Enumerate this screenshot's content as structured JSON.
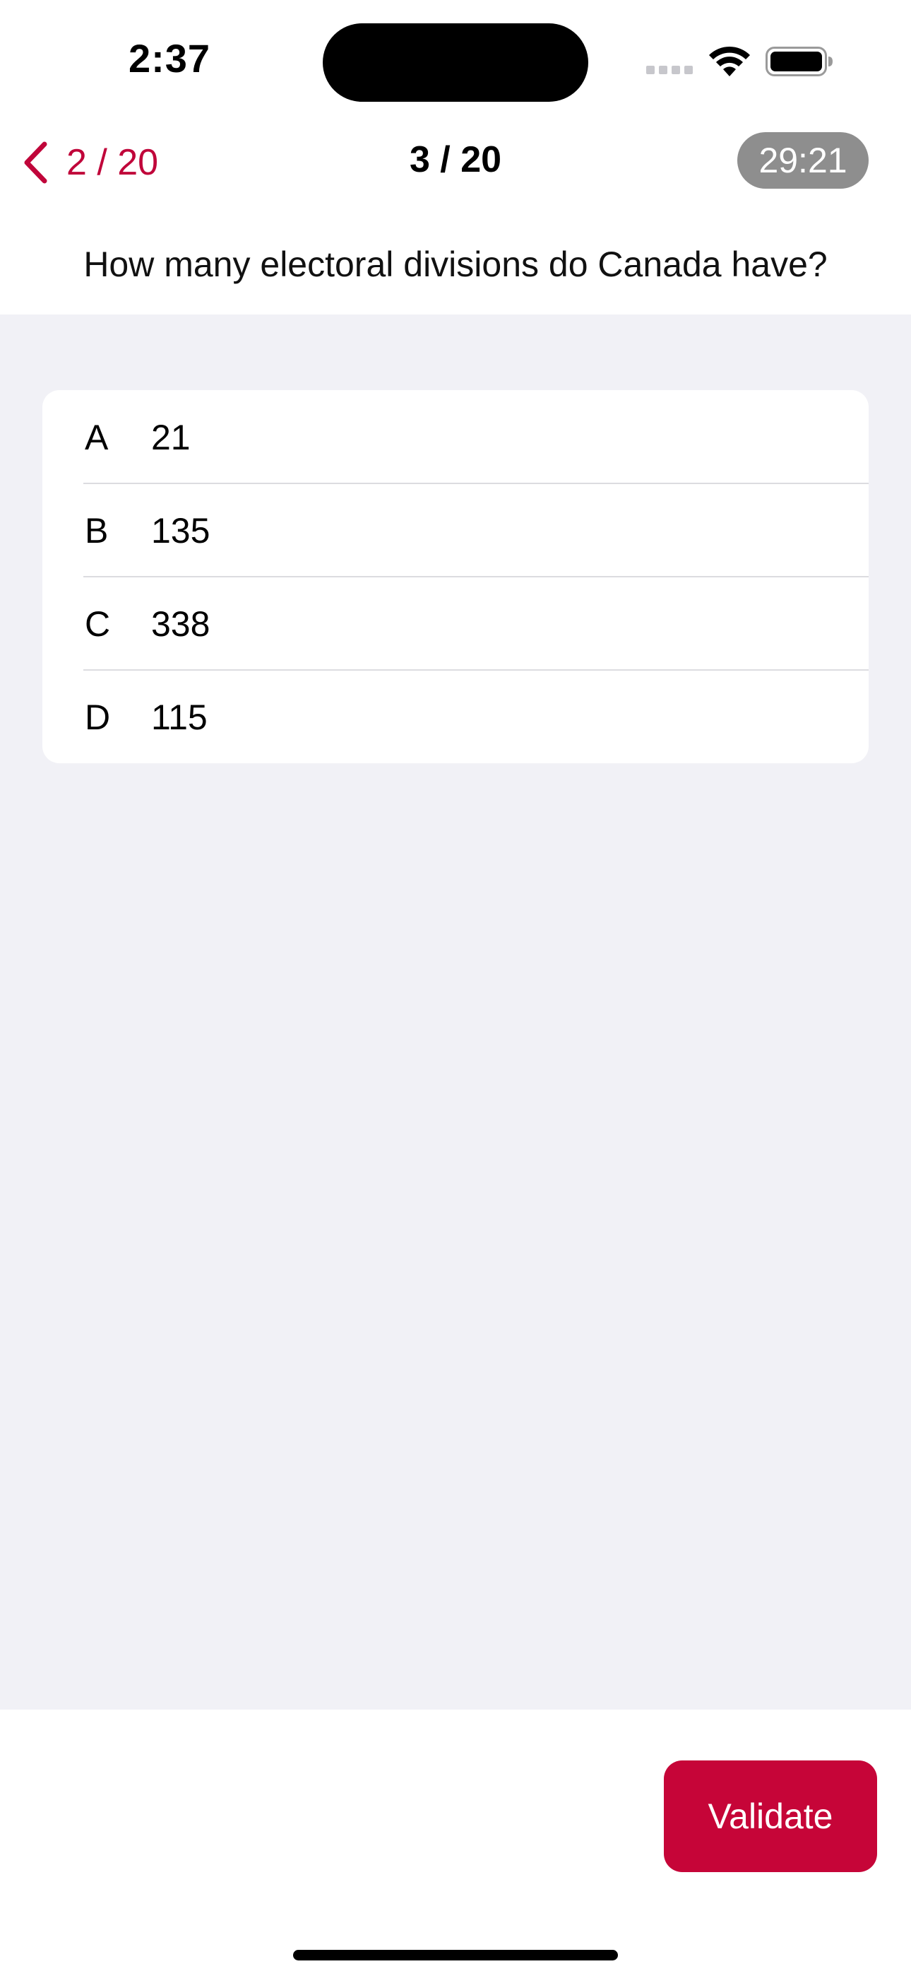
{
  "status_bar": {
    "time": "2:37",
    "icons": [
      "signal-icon",
      "wifi-icon",
      "battery-icon"
    ]
  },
  "nav": {
    "back_label": "2 / 20",
    "title": "3 / 20",
    "timer": "29:21",
    "accent_color": "#c0053a"
  },
  "question": {
    "text": "How many electoral divisions do Canada have?"
  },
  "answers": [
    {
      "letter": "A",
      "value": "21"
    },
    {
      "letter": "B",
      "value": "135"
    },
    {
      "letter": "C",
      "value": "338"
    },
    {
      "letter": "D",
      "value": "115"
    }
  ],
  "footer": {
    "validate_label": "Validate",
    "button_color": "#c60538"
  }
}
